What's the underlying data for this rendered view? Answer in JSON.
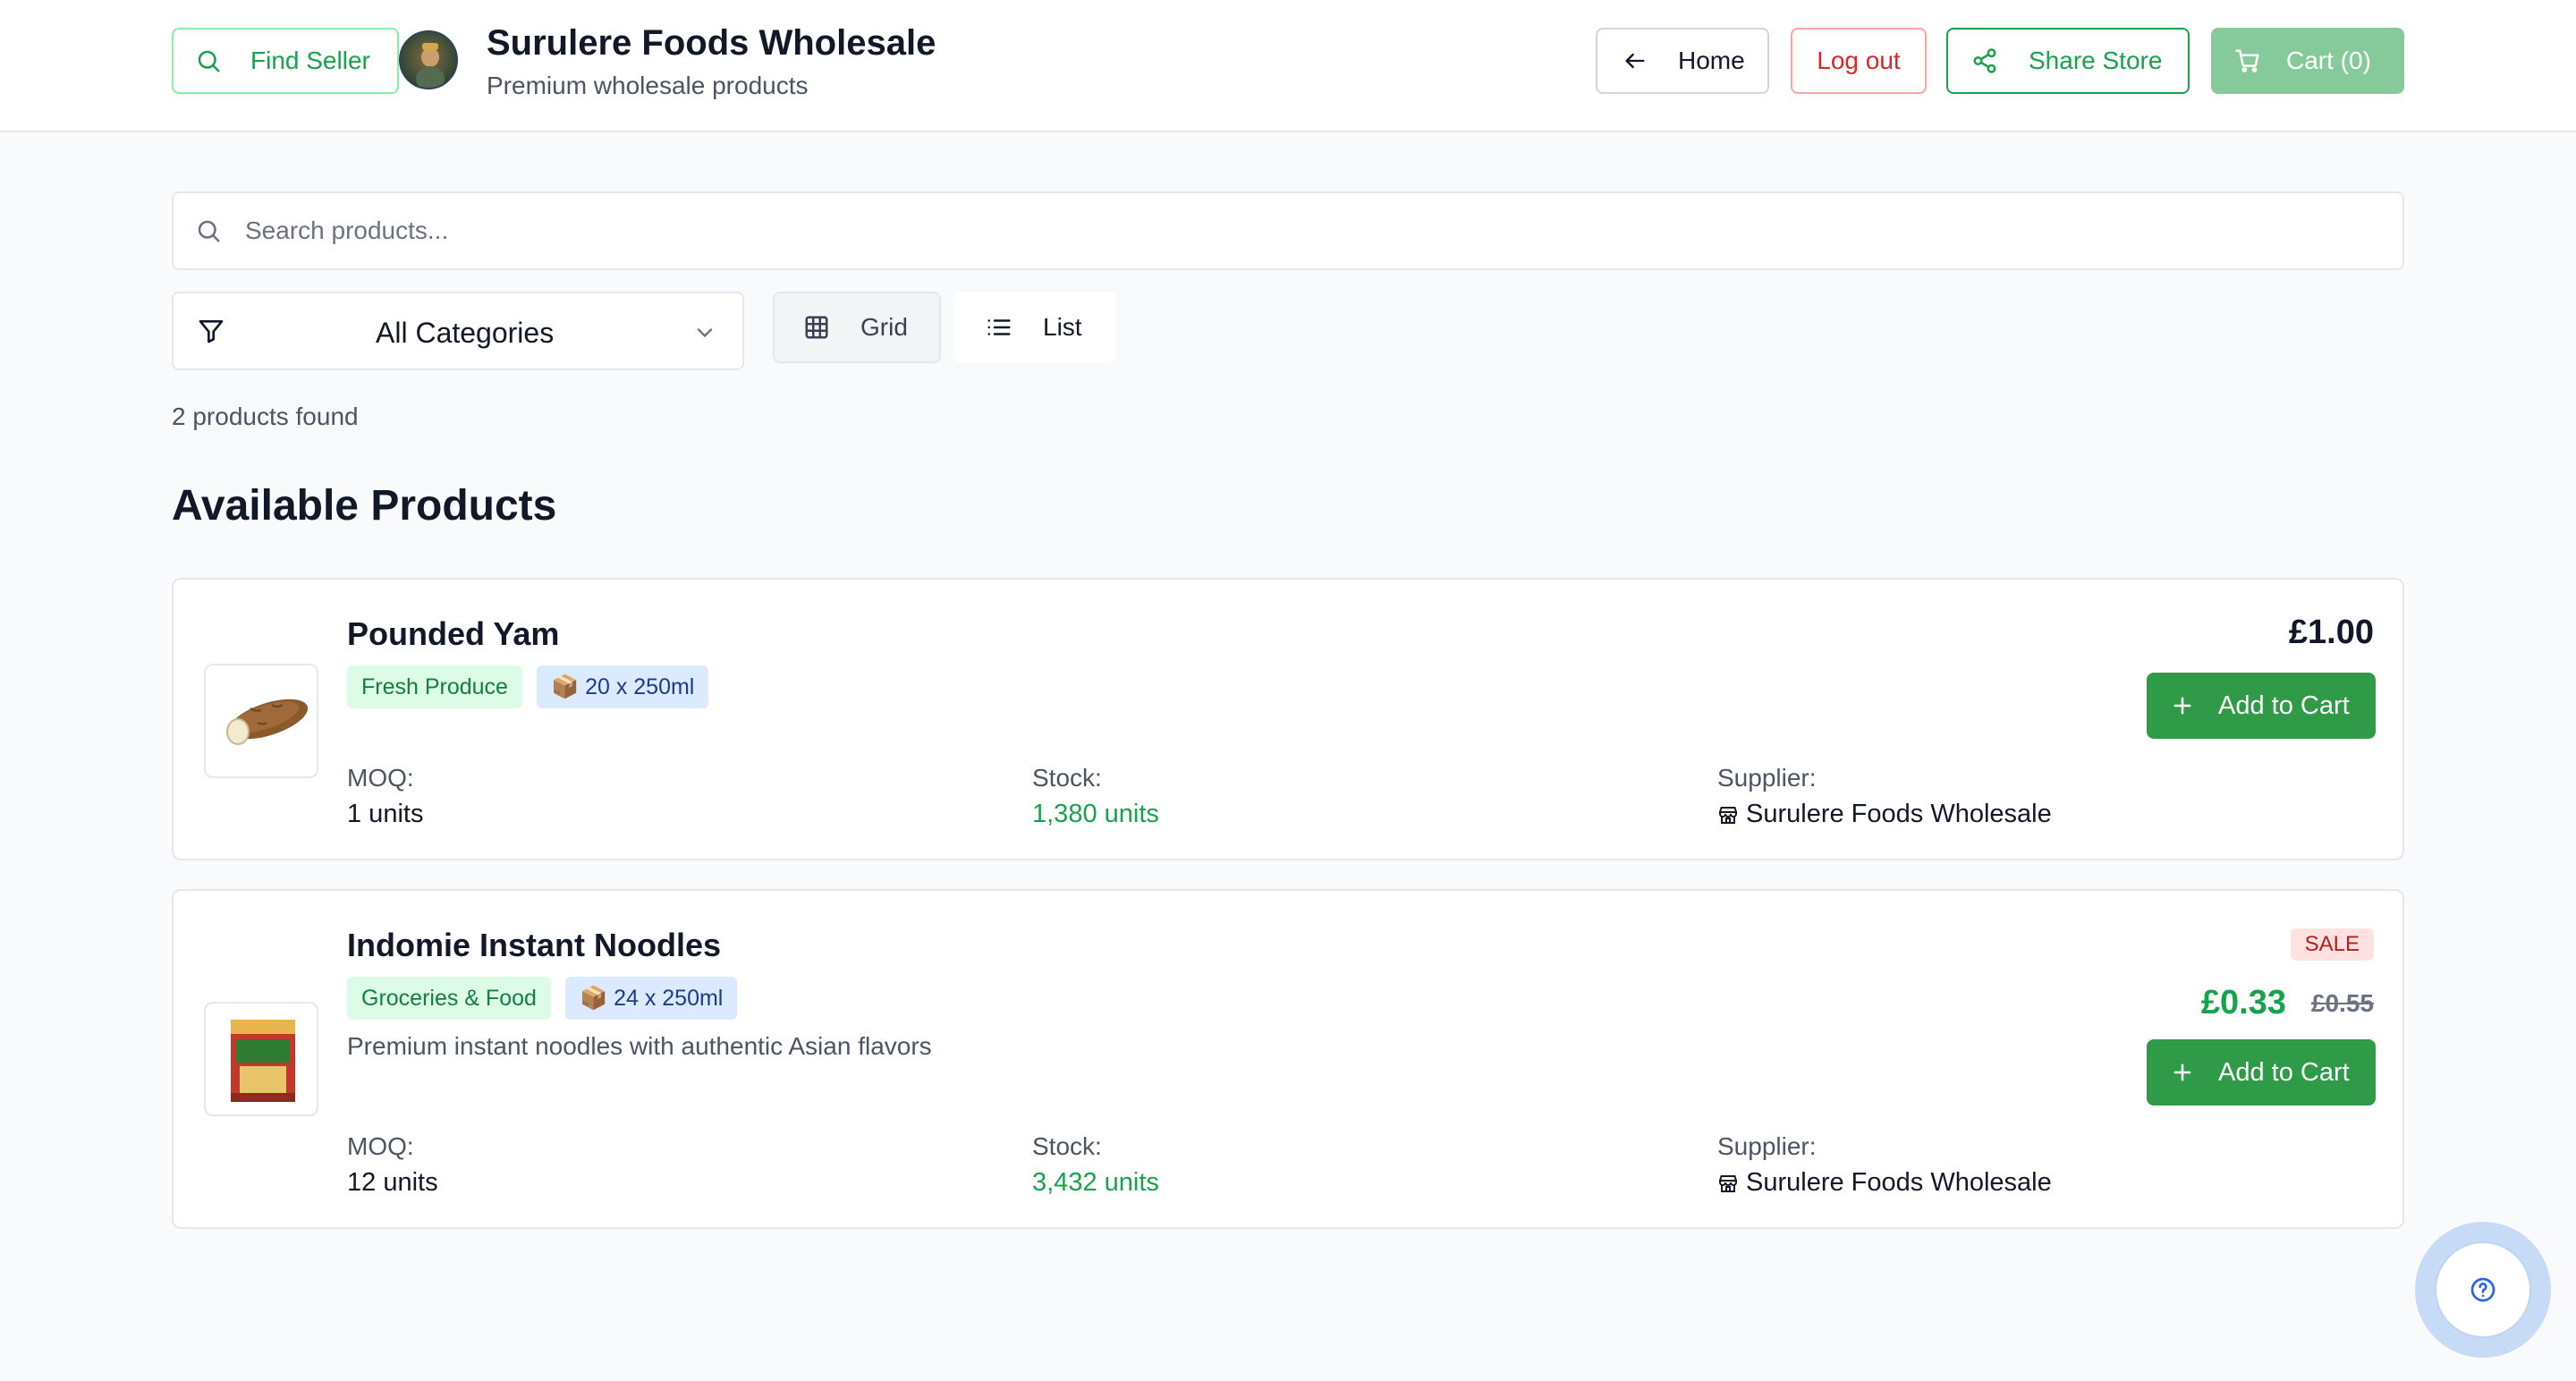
{
  "header": {
    "find_seller": "Find Seller",
    "store_name": "Surulere Foods Wholesale",
    "store_tagline": "Premium wholesale products",
    "home": "Home",
    "logout": "Log out",
    "share": "Share Store",
    "cart": "Cart (0)"
  },
  "search": {
    "placeholder": "Search products..."
  },
  "filters": {
    "category": "All Categories",
    "view_grid": "Grid",
    "view_list": "List"
  },
  "results": {
    "count_text": "2 products found",
    "section_title": "Available Products"
  },
  "labels": {
    "moq": "MOQ:",
    "stock": "Stock:",
    "supplier": "Supplier:",
    "add_to_cart": "Add to Cart",
    "sale": "SALE"
  },
  "products": [
    {
      "name": "Pounded Yam",
      "category": "Fresh Produce",
      "pack": "📦 20 x 250ml",
      "description": "",
      "moq": "1 units",
      "stock": "1,380 units",
      "supplier": "Surulere Foods Wholesale",
      "price": "£1.00"
    },
    {
      "name": "Indomie Instant Noodles",
      "category": "Groceries & Food",
      "pack": "📦 24 x 250ml",
      "description": "Premium instant noodles with authentic Asian flavors",
      "moq": "12 units",
      "stock": "3,432 units",
      "supplier": "Surulere Foods Wholesale",
      "price": "£0.33",
      "old_price": "£0.55"
    }
  ],
  "colors": {
    "brand_green": "#16a34a",
    "danger_red": "#dc2626",
    "cart_disabled": "#86c99a",
    "help_ring": "#c7dbf7"
  },
  "icons": [
    "search-icon",
    "arrow-left-icon",
    "share-icon",
    "cart-icon",
    "filter-icon",
    "chevron-down-icon",
    "grid-icon",
    "list-icon",
    "plus-icon",
    "store-icon",
    "help-icon"
  ]
}
